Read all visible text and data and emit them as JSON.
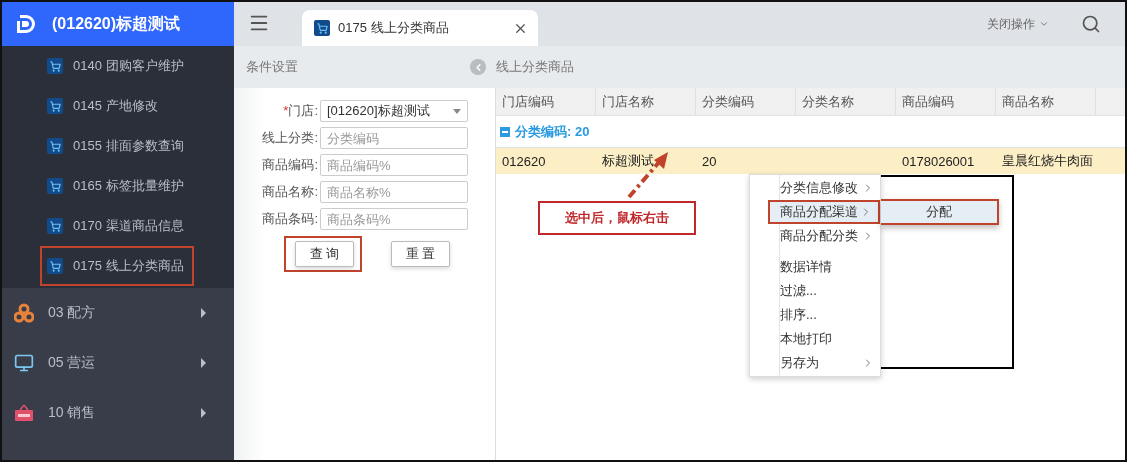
{
  "app": {
    "title": "(012620)标超测试"
  },
  "sidebar": {
    "sub_items": [
      {
        "label": "0140 团购客户维护",
        "annotated": false
      },
      {
        "label": "0145 产地修改",
        "annotated": false
      },
      {
        "label": "0155 排面参数查询",
        "annotated": false
      },
      {
        "label": "0165 标签批量维护",
        "annotated": false
      },
      {
        "label": "0170 渠道商品信息",
        "annotated": false
      },
      {
        "label": "0175 线上分类商品",
        "annotated": true
      }
    ],
    "groups": [
      {
        "label": "03 配方",
        "kind": "recipe"
      },
      {
        "label": "05 营运",
        "kind": "monitor"
      },
      {
        "label": "10 销售",
        "kind": "sale"
      }
    ]
  },
  "topbar": {
    "tabs": [
      {
        "label": "0175 线上分类商品",
        "selected": true
      }
    ],
    "close_menu": "关闭操作"
  },
  "subheader": {
    "left_title": "条件设置",
    "right_title": "线上分类商品"
  },
  "form": {
    "fields": [
      {
        "mark": "*",
        "label": "门店:",
        "kind": "select",
        "value": "[012620]标超测试"
      },
      {
        "label": "线上分类:",
        "kind": "text",
        "placeholder": "分类编码"
      },
      {
        "label": "商品编码:",
        "kind": "text",
        "placeholder": "商品编码%"
      },
      {
        "label": "商品名称:",
        "kind": "text",
        "placeholder": "商品名称%"
      },
      {
        "label": "商品条码:",
        "kind": "text",
        "placeholder": "商品条码%"
      }
    ],
    "buttons": [
      {
        "label": "查 询",
        "annotated": true
      },
      {
        "label": "重 置",
        "annotated": false
      }
    ]
  },
  "grid": {
    "columns": [
      "门店编码",
      "门店名称",
      "分类编码",
      "分类名称",
      "商品编码",
      "商品名称"
    ],
    "group": {
      "label": "分类编码: 20",
      "expanded": true
    },
    "rows": [
      {
        "selected": true,
        "cells": [
          "012620",
          "标超测试",
          "20",
          null,
          "0178026001",
          "皇晨红烧牛肉面"
        ]
      }
    ]
  },
  "context_menu": {
    "items": [
      {
        "label": "分类信息修改",
        "submenu": true,
        "highlighted": false,
        "annotated": false,
        "separator_before": false
      },
      {
        "label": "商品分配渠道",
        "submenu": true,
        "highlighted": true,
        "annotated": true,
        "separator_before": false,
        "children": [
          {
            "label": "分配"
          }
        ]
      },
      {
        "label": "商品分配分类",
        "submenu": true,
        "highlighted": false,
        "annotated": false,
        "separator_before": false
      },
      {
        "label": "数据详情",
        "submenu": false,
        "highlighted": false,
        "annotated": false,
        "separator_before": true
      },
      {
        "label": "过滤...",
        "submenu": false,
        "highlighted": false,
        "annotated": false,
        "separator_before": false
      },
      {
        "label": "排序...",
        "submenu": false,
        "highlighted": false,
        "annotated": false,
        "separator_before": false
      },
      {
        "label": "本地打印",
        "submenu": false,
        "highlighted": false,
        "annotated": false,
        "separator_before": false
      },
      {
        "label": "另存为",
        "submenu": true,
        "highlighted": false,
        "annotated": false,
        "separator_before": false
      }
    ]
  },
  "annotation": {
    "callout": "选中后，鼠标右击"
  }
}
